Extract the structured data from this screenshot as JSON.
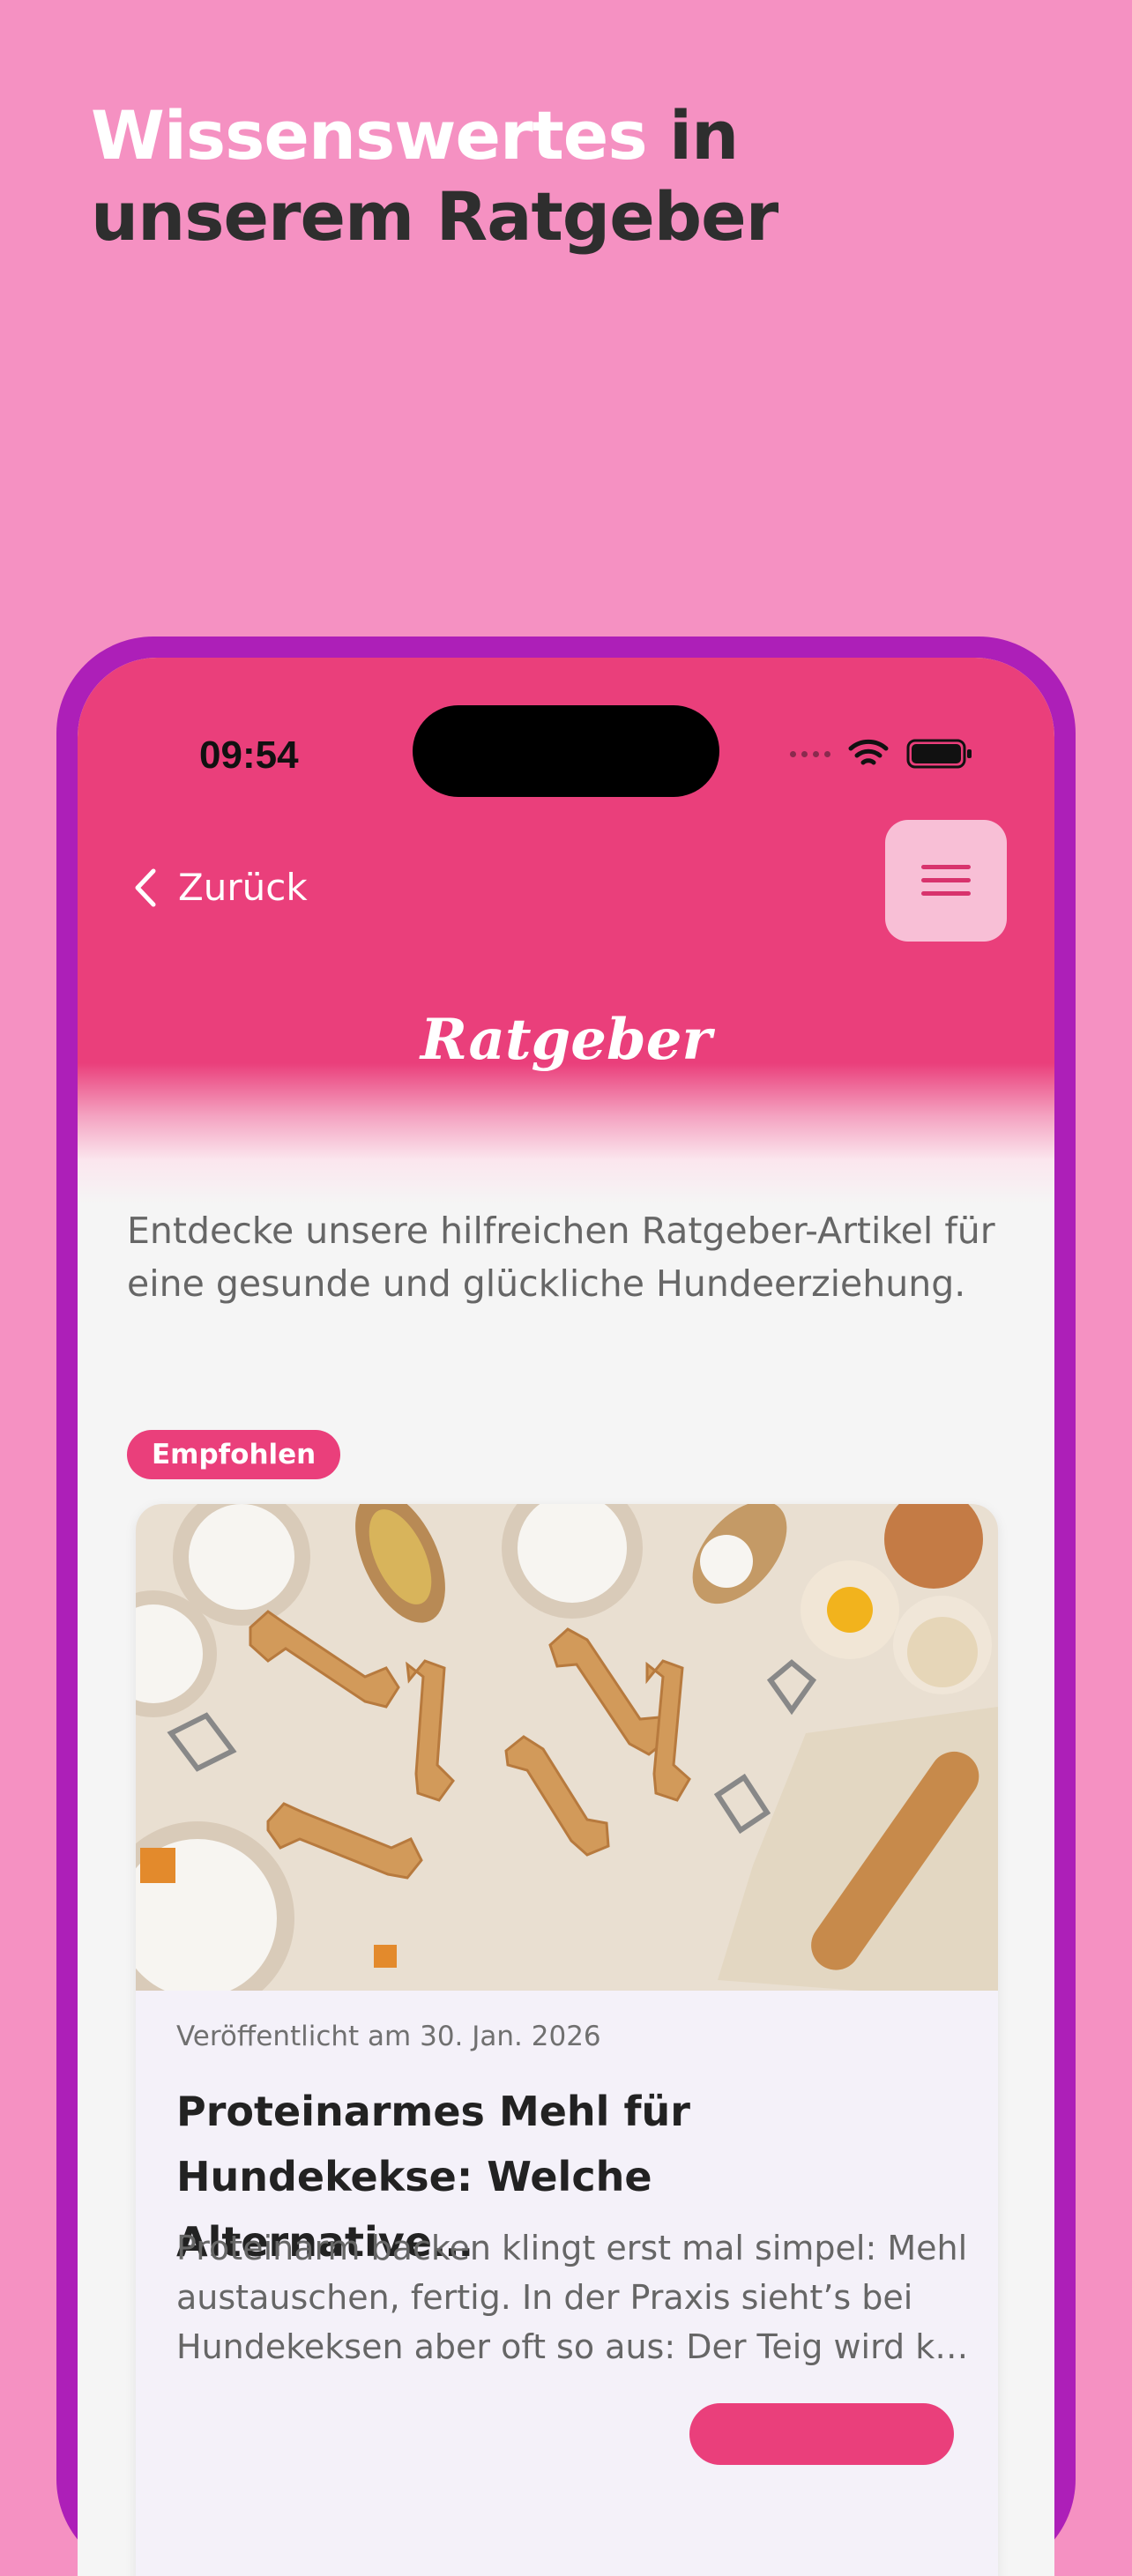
{
  "promo": {
    "headline_highlight": "Wissenswertes",
    "headline_rest1": " in",
    "headline_line2": "unserem Ratgeber"
  },
  "status_bar": {
    "time": "09:54"
  },
  "nav": {
    "back_label": "Zurück"
  },
  "page": {
    "title": "Ratgeber",
    "intro": "Entdecke unsere hilfreichen Ratgeber-Artikel für eine gesunde und glückliche Hundeerziehung.",
    "featured_badge": "Empfohlen"
  },
  "article": {
    "published": "Veröffentlicht am 30. Jan. 2026",
    "title": "Proteinarmes Mehl für Hundekekse: Welche Alternative…",
    "excerpt": "Proteinarm backen klingt erst mal simpel: Mehl austauschen, fertig. In der Praxis sieht’s bei Hundekeksen aber oft so aus: Der Teig wird k…"
  },
  "colors": {
    "background": "#f591c2",
    "phone_frame": "#ad1fb8",
    "accent": "#ea3f7b",
    "menu_button_bg": "#f8bfd6"
  },
  "icons": [
    "chevron-left-icon",
    "hamburger-menu-icon",
    "wifi-icon",
    "battery-icon",
    "signal-dots-icon"
  ]
}
